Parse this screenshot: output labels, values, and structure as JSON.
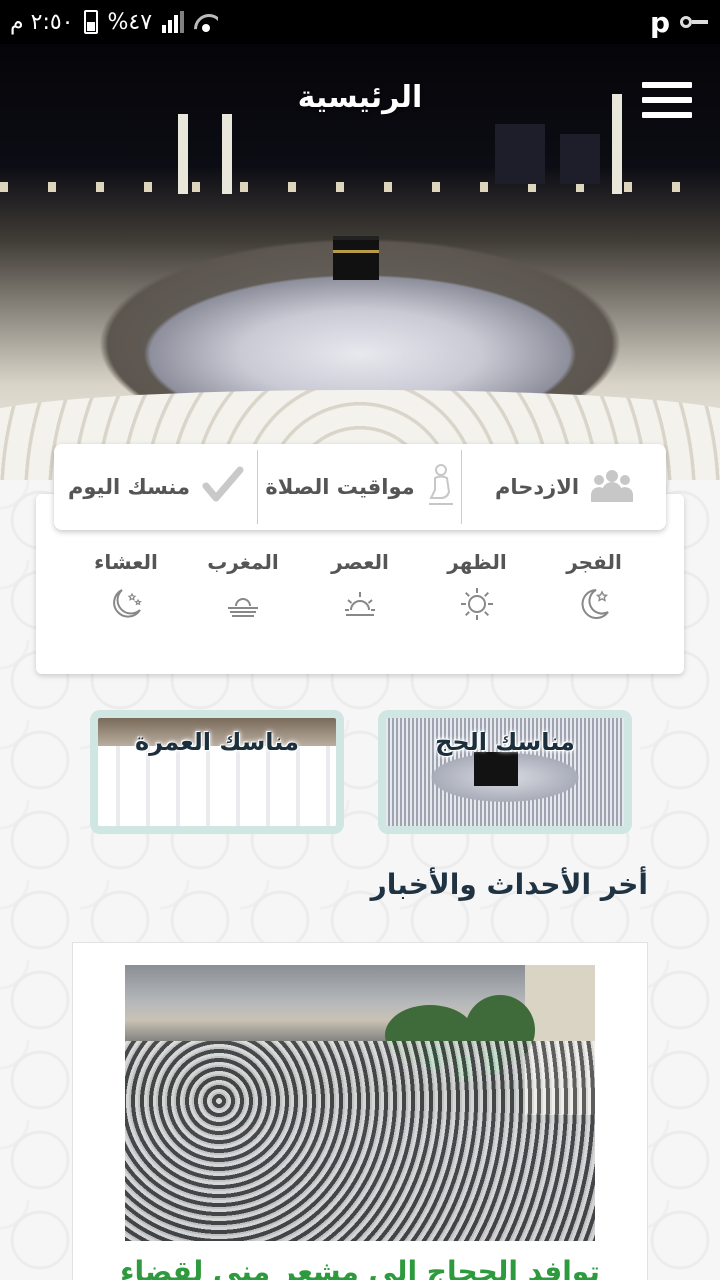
{
  "status_bar": {
    "time": "٢:٥٠ م",
    "battery": "%٤٧"
  },
  "header": {
    "title": "الرئيسية"
  },
  "tabs": [
    {
      "label": "الازدحام",
      "icon": "crowd-icon"
    },
    {
      "label": "مواقيت الصلاة",
      "icon": "praying-person-icon"
    },
    {
      "label": "منسك اليوم",
      "icon": "checkmark-icon"
    }
  ],
  "prayers": [
    {
      "name": "الفجر",
      "icon": "crescent-star-icon"
    },
    {
      "name": "الظهر",
      "icon": "sun-icon"
    },
    {
      "name": "العصر",
      "icon": "sun-half-icon"
    },
    {
      "name": "المغرب",
      "icon": "sunset-icon"
    },
    {
      "name": "العشاء",
      "icon": "crescent-stars-icon"
    }
  ],
  "rites": {
    "hajj": {
      "title": "مناسك الحج"
    },
    "umrah": {
      "title": "مناسك العمرة"
    }
  },
  "news": {
    "section_title": "أخر الأحداث والأخبار",
    "items": [
      {
        "headline": "توافد الحجاج الى مشعر منى لقضاء"
      }
    ]
  },
  "colors": {
    "accent_green": "#2e9a3e",
    "title_dark": "#1f3342",
    "rite_border": "#cfe6e2"
  }
}
